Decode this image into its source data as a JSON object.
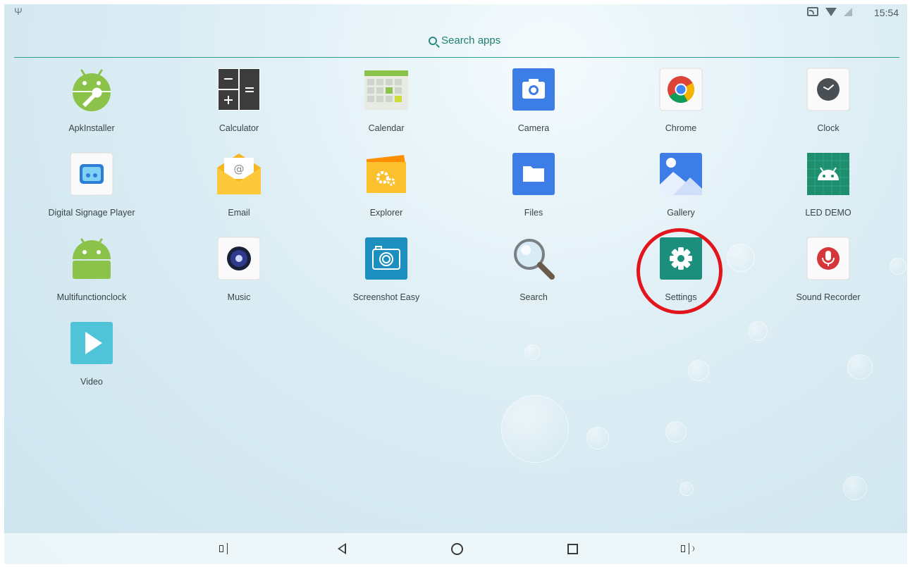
{
  "status_bar": {
    "time": "15:54",
    "icons": [
      "usb-icon",
      "cast-icon",
      "wifi-icon",
      "no-signal-icon"
    ]
  },
  "search": {
    "label": "Search apps",
    "icon": "search-icon"
  },
  "apps": [
    {
      "label": "ApkInstaller",
      "icon": "android-wrench-icon"
    },
    {
      "label": "Calculator",
      "icon": "calculator-icon"
    },
    {
      "label": "Calendar",
      "icon": "calendar-icon"
    },
    {
      "label": "Camera",
      "icon": "camera-icon"
    },
    {
      "label": "Chrome",
      "icon": "chrome-icon"
    },
    {
      "label": "Clock",
      "icon": "clock-icon"
    },
    {
      "label": "Digital Signage Player",
      "icon": "signage-player-icon"
    },
    {
      "label": "Email",
      "icon": "email-icon"
    },
    {
      "label": "Explorer",
      "icon": "explorer-folder-icon"
    },
    {
      "label": "Files",
      "icon": "files-folder-icon"
    },
    {
      "label": "Gallery",
      "icon": "gallery-icon"
    },
    {
      "label": "LED DEMO",
      "icon": "android-led-icon"
    },
    {
      "label": "Multifunctionclock",
      "icon": "android-icon"
    },
    {
      "label": "Music",
      "icon": "music-speaker-icon"
    },
    {
      "label": "Screenshot Easy",
      "icon": "screenshot-camera-icon"
    },
    {
      "label": "Search",
      "icon": "magnifier-icon"
    },
    {
      "label": "Settings",
      "icon": "settings-gear-icon",
      "highlighted": true
    },
    {
      "label": "Sound Recorder",
      "icon": "microphone-icon"
    },
    {
      "label": "Video",
      "icon": "play-icon"
    }
  ],
  "highlight_color": "#e2141c",
  "accent_color": "#2a9d8f",
  "nav_bar": {
    "buttons": [
      "volume-down-icon",
      "back-icon",
      "home-icon",
      "recents-icon",
      "volume-up-icon"
    ]
  }
}
